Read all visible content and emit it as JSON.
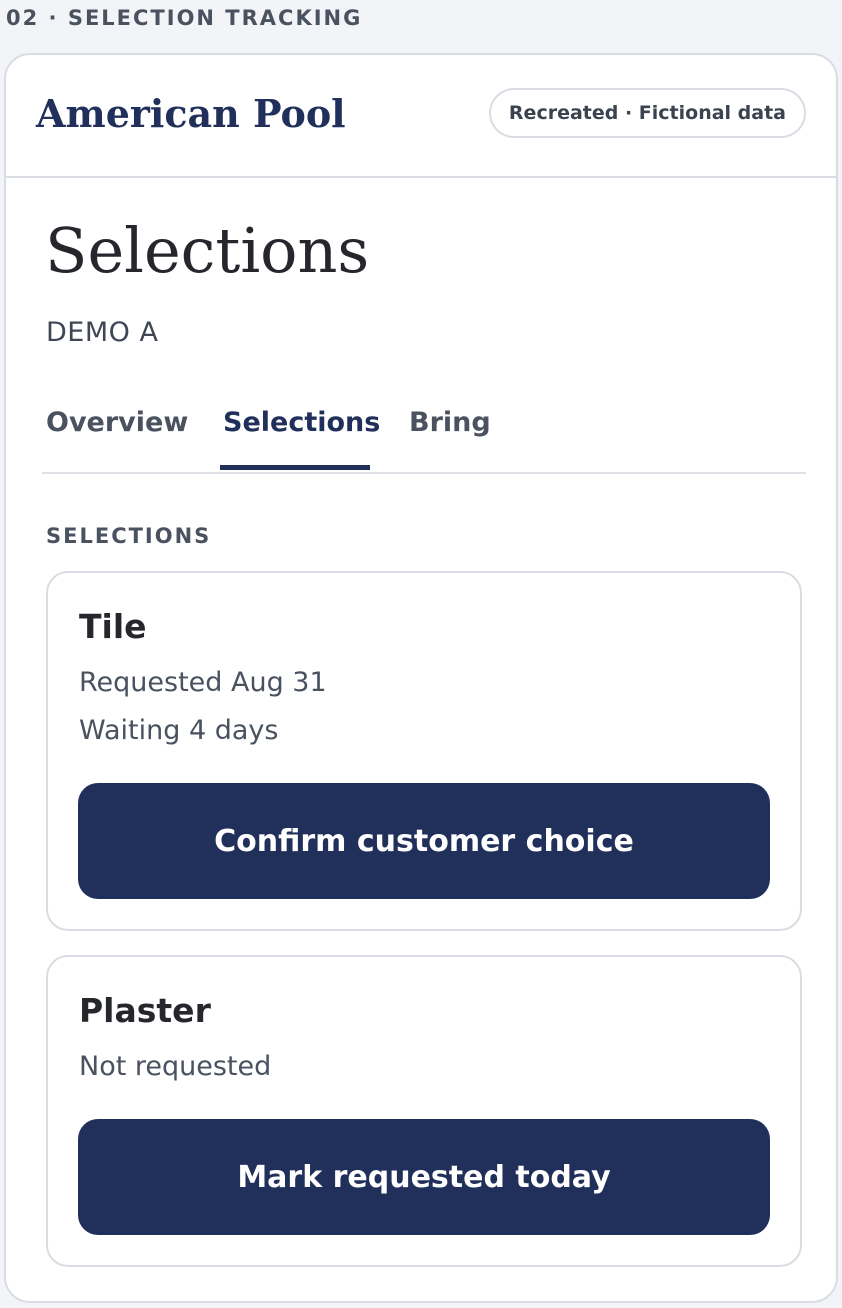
{
  "section_label": "02 · SELECTION TRACKING",
  "header": {
    "brand": "American Pool",
    "badge": "Recreated · Fictional data"
  },
  "page": {
    "title": "Selections",
    "subtitle": "DEMO A"
  },
  "tabs": [
    {
      "label": "Overview",
      "active": false
    },
    {
      "label": "Selections",
      "active": true
    },
    {
      "label": "Bring",
      "active": false
    }
  ],
  "list_heading": "SELECTIONS",
  "cards": [
    {
      "title": "Tile",
      "lines": [
        "Requested Aug 31",
        "Waiting 4 days"
      ],
      "button": "Confirm customer choice"
    },
    {
      "title": "Plaster",
      "lines": [
        "Not requested"
      ],
      "button": "Mark requested today"
    }
  ],
  "colors": {
    "brand_navy": "#21305b",
    "background": "#f3f4f7",
    "border": "#d9dce2"
  }
}
